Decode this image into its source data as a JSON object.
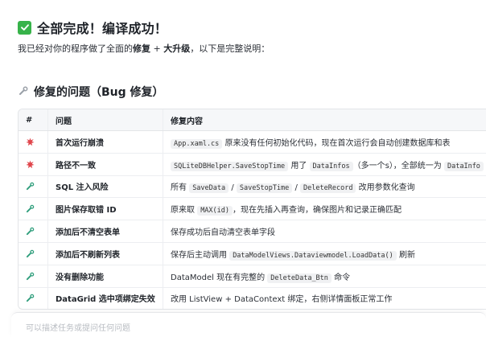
{
  "heading": {
    "title": "全部完成！编译成功！"
  },
  "intro": {
    "prefix": "我已经对你的程序做了全面的",
    "fix": "修复",
    "plus": " + ",
    "upgrade": "大升级",
    "suffix": "，以下是完整说明："
  },
  "section": {
    "title": "修复的问题（Bug 修复）"
  },
  "table": {
    "headers": [
      "#",
      "问题",
      "修复内容"
    ],
    "rows": [
      {
        "icon": "burst-icon",
        "issue": "首次运行崩溃",
        "parts": [
          {
            "code": "App.xaml.cs"
          },
          {
            "text": " 原来没有任何初始化代码，现在首次运行会自动创建数据库和表"
          }
        ]
      },
      {
        "icon": "burst-icon",
        "issue": "路径不一致",
        "parts": [
          {
            "code": "SQLiteDBHelper.SaveStopTime"
          },
          {
            "text": " 用了 "
          },
          {
            "code": "DataInfos"
          },
          {
            "text": "（多一个s），全部统一为 "
          },
          {
            "code": "DataInfo"
          }
        ]
      },
      {
        "icon": "wrench-icon",
        "issue": "SQL 注入风险",
        "parts": [
          {
            "text": "所有 "
          },
          {
            "code": "SaveData"
          },
          {
            "text": " / "
          },
          {
            "code": "SaveStopTime"
          },
          {
            "text": " / "
          },
          {
            "code": "DeleteRecord"
          },
          {
            "text": " 改用参数化查询"
          }
        ]
      },
      {
        "icon": "wrench-icon",
        "issue": "图片保存取错 ID",
        "parts": [
          {
            "text": "原来取 "
          },
          {
            "code": "MAX(id)"
          },
          {
            "text": "，现在先插入再查询，确保图片和记录正确匹配"
          }
        ]
      },
      {
        "icon": "wrench-icon",
        "issue": "添加后不清空表单",
        "parts": [
          {
            "text": "保存成功后自动清空表单字段"
          }
        ]
      },
      {
        "icon": "wrench-icon",
        "issue": "添加后不刷新列表",
        "parts": [
          {
            "text": "保存后主动调用 "
          },
          {
            "code": "DataModelViews.Dataviewmodel.LoadData()"
          },
          {
            "text": " 刷新"
          }
        ]
      },
      {
        "icon": "wrench-icon",
        "issue": "没有删除功能",
        "parts": [
          {
            "text": "DataModel 现在有完整的 "
          },
          {
            "code": "DeleteData_Btn"
          },
          {
            "text": " 命令"
          }
        ]
      },
      {
        "icon": "wrench-icon",
        "issue": "DataGrid 选中项绑定失效",
        "parts": [
          {
            "text": "改用 ListView + DataContext 绑定，右侧详情面板正常工作"
          }
        ]
      }
    ]
  },
  "input": {
    "placeholder": "可以描述任务或提问任何问题"
  },
  "colors": {
    "check": "#37b34a",
    "burst": "#e0454b",
    "wrench": "#2f9e7c"
  }
}
